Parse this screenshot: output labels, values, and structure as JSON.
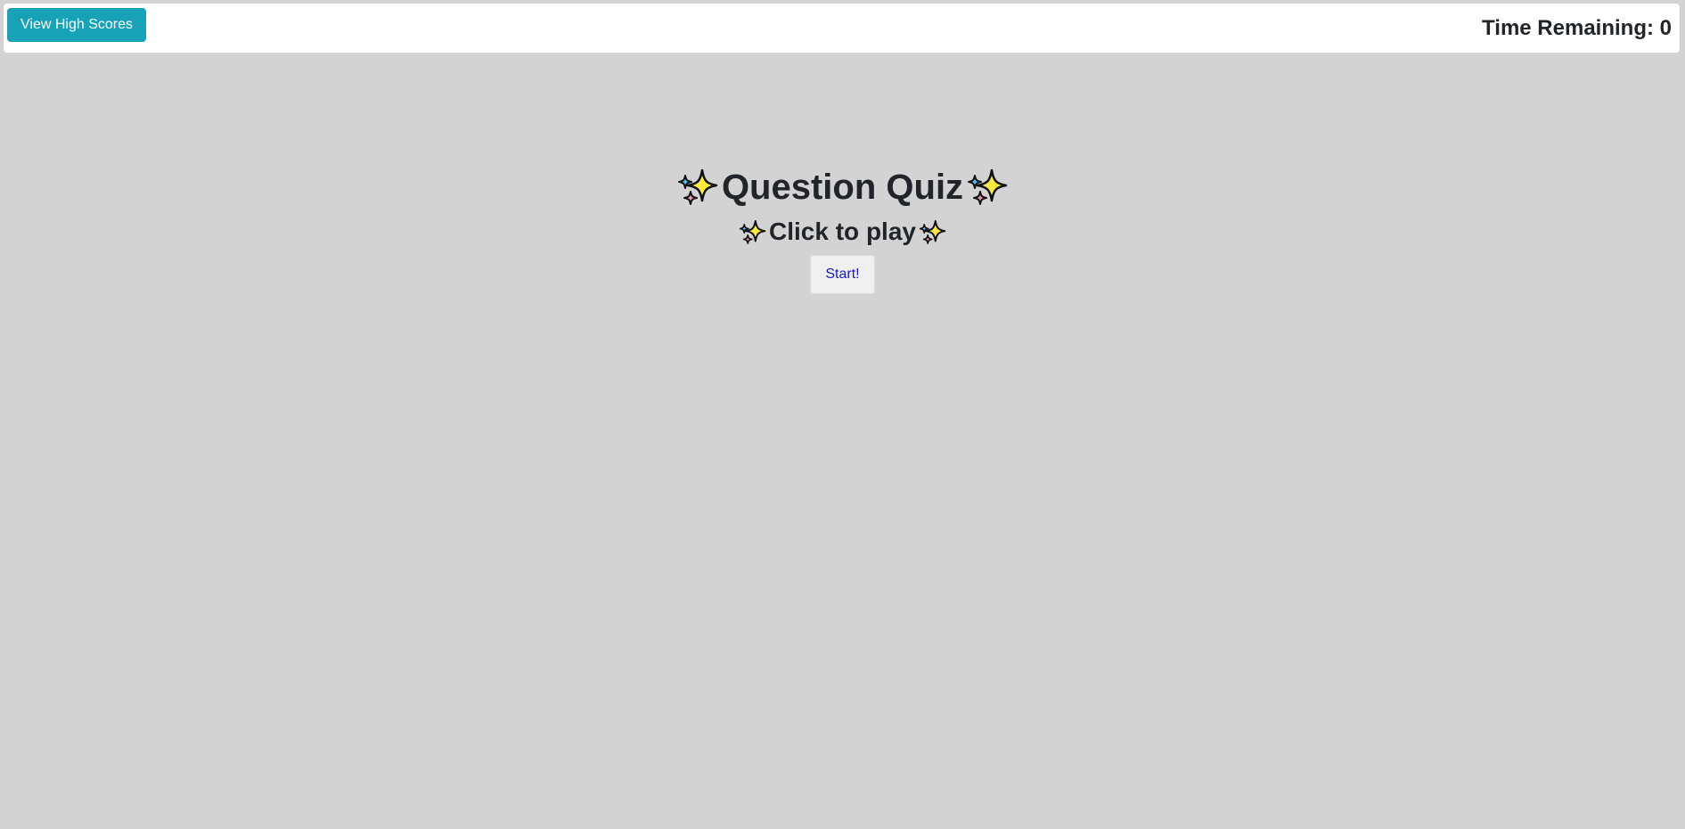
{
  "header": {
    "high_scores_label": "View High Scores",
    "timer_label": "Time Remaining: ",
    "timer_value": "0"
  },
  "main": {
    "title": "Question Quiz",
    "subtitle": "Click to play",
    "start_label": "Start!",
    "decoration_icon": "sparkles-icon"
  },
  "colors": {
    "page_background": "#d3d3d3",
    "header_background": "#ffffff",
    "high_scores_button": "#17a2b8",
    "start_button_text": "#1a1ac8",
    "sparkle_yellow": "#ffeb3b",
    "sparkle_cyan": "#4fc3f7",
    "sparkle_pink": "#f48fb1"
  }
}
